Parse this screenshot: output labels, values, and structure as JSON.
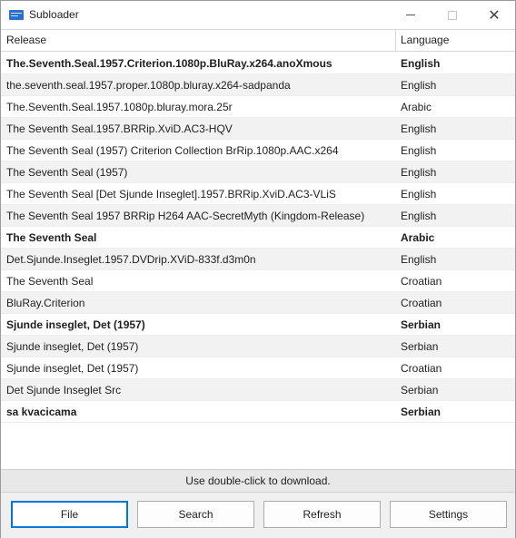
{
  "window": {
    "title": "Subloader",
    "icon": "subtitle-app-icon",
    "controls": [
      "minimize-icon",
      "maximize-icon",
      "close-icon"
    ],
    "close_glyph": "✕"
  },
  "table": {
    "headers": {
      "release": "Release",
      "language": "Language"
    },
    "rows": [
      {
        "release": "The.Seventh.Seal.1957.Criterion.1080p.BluRay.x264.anoXmous",
        "language": "English",
        "bold": true
      },
      {
        "release": "the.seventh.seal.1957.proper.1080p.bluray.x264-sadpanda",
        "language": "English",
        "bold": false
      },
      {
        "release": "The.Seventh.Seal.1957.1080p.bluray.mora.25r",
        "language": "Arabic",
        "bold": false
      },
      {
        "release": "The Seventh Seal.1957.BRRip.XviD.AC3-HQV",
        "language": "English",
        "bold": false
      },
      {
        "release": "The Seventh Seal (1957) Criterion Collection BrRip.1080p.AAC.x264",
        "language": "English",
        "bold": false
      },
      {
        "release": "The Seventh Seal (1957)",
        "language": "English",
        "bold": false
      },
      {
        "release": "The Seventh Seal [Det Sjunde Inseglet].1957.BRRip.XviD.AC3-VLiS",
        "language": "English",
        "bold": false
      },
      {
        "release": "The Seventh Seal 1957 BRRip H264 AAC-SecretMyth (Kingdom-Release)",
        "language": "English",
        "bold": false
      },
      {
        "release": "The Seventh Seal",
        "language": "Arabic",
        "bold": true
      },
      {
        "release": "Det.Sjunde.Inseglet.1957.DVDrip.XViD-833f.d3m0n",
        "language": "English",
        "bold": false
      },
      {
        "release": "The Seventh Seal",
        "language": "Croatian",
        "bold": false
      },
      {
        "release": "BluRay.Criterion",
        "language": "Croatian",
        "bold": false
      },
      {
        "release": "Sjunde inseglet, Det (1957)",
        "language": "Serbian",
        "bold": true
      },
      {
        "release": "Sjunde inseglet, Det (1957)",
        "language": "Serbian",
        "bold": false
      },
      {
        "release": "Sjunde inseglet, Det (1957)",
        "language": "Croatian",
        "bold": false
      },
      {
        "release": "Det Sjunde Inseglet Src",
        "language": "Serbian",
        "bold": false
      },
      {
        "release": "sa kvacicama",
        "language": "Serbian",
        "bold": true
      }
    ]
  },
  "status": {
    "text": "Use double-click to download."
  },
  "buttons": {
    "file": "File",
    "search": "Search",
    "refresh": "Refresh",
    "settings": "Settings"
  },
  "colors": {
    "focus_accent": "#0078d7",
    "row_alt": "#f2f2f2",
    "status_bg": "#e8e8e8"
  }
}
